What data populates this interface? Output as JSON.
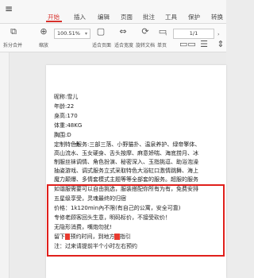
{
  "menubar": {
    "tabs": [
      "开始",
      "插入",
      "编辑",
      "页面",
      "批注",
      "工具",
      "保护",
      "转换"
    ],
    "active_tab": "开始",
    "accent_color": "#d8302b"
  },
  "toolbar": {
    "items": [
      {
        "label": "拆分合并",
        "icon": "split-merge-icon"
      },
      {
        "label": "缩放",
        "icon": "zoom-icon"
      },
      {
        "label": "适合页面",
        "icon": "fit-page-icon"
      },
      {
        "label": "适合宽度",
        "icon": "fit-width-icon"
      },
      {
        "label": "旋转文档",
        "icon": "rotate-icon"
      },
      {
        "label": "单页",
        "icon": "single-page-icon"
      },
      {
        "label": "双页",
        "icon": "double-page-icon"
      },
      {
        "label": "连续阅读",
        "icon": "continuous-icon"
      },
      {
        "label": "自动滚动",
        "icon": "auto-scroll-icon"
      }
    ],
    "zoom_value": "100.51%",
    "page_value": "1/1"
  },
  "document": {
    "lines": [
      "昵称:雪儿",
      "年龄:22",
      "身高:170",
      "体重:48KG",
      "胸围:D",
      "定制特色服务:三部三落、小野猫扑、温泉养护、绿帝擎体、",
      "高山流水、玉女硬身、舌头按摩、麻意娇喘、海底捞月、冰",
      "制服丝袜调情、角色扮演、秘密深入、玉指挑逗、助浴泡澡",
      "抽姿游戏、调式服务立式采取特色大浴缸口激情跳舞、海上",
      "魔力颠爆、多情套模式主题等等全部套的服务。超服的服务",
      "如谐服需要可以自由挑选，服装搭配你所有为有，免费安排",
      "五星级享受，灵魂最终的归宿",
      "价格：1k120min內不限(有自己的公寓，安全可靠)",
      "专修老顾客回头生意，明码标价，不接受砍价！",
      "无隐形消费，嘴炮勿扰!",
      "留下 预约时间，到地方 指引",
      "注：过来请提前半个小时左右预约"
    ],
    "highlight_color": "#e83b30",
    "box_color": "#e0201c"
  }
}
